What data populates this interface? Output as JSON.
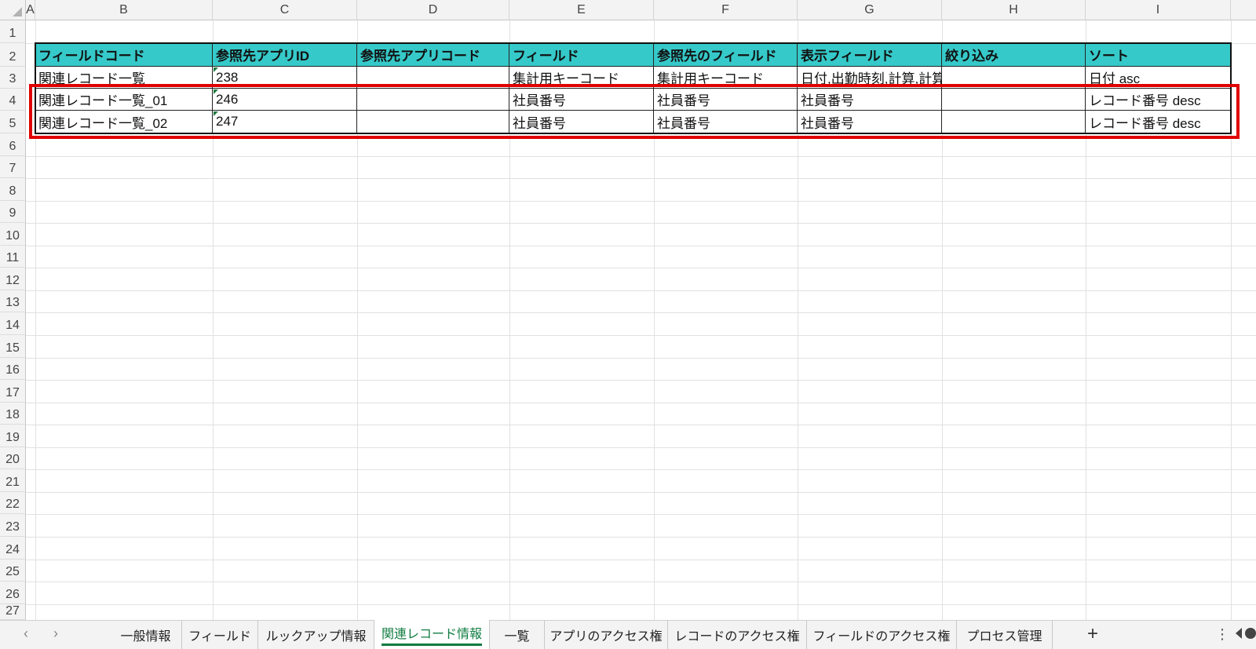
{
  "columns": [
    "A",
    "B",
    "C",
    "D",
    "E",
    "F",
    "G",
    "H",
    "I"
  ],
  "rows": [
    "1",
    "2",
    "3",
    "4",
    "5",
    "6",
    "7",
    "8",
    "9",
    "10",
    "11",
    "12",
    "13",
    "14",
    "15",
    "16",
    "17",
    "18",
    "19",
    "20",
    "21",
    "22",
    "23",
    "24",
    "25",
    "26",
    "27"
  ],
  "table": {
    "headers": [
      "フィールドコード",
      "参照先アプリID",
      "参照先アプリコード",
      "フィールド",
      "参照先のフィールド",
      "表示フィールド",
      "絞り込み",
      "ソート"
    ],
    "rows": [
      [
        "関連レコード一覧",
        "238",
        "",
        "集計用キーコード",
        "集計用キーコード",
        "日付,出勤時刻,計算,計算",
        "",
        "日付 asc"
      ],
      [
        "関連レコード一覧_01",
        "246",
        "",
        "社員番号",
        "社員番号",
        "社員番号",
        "",
        "レコード番号 desc"
      ],
      [
        "関連レコード一覧_02",
        "247",
        "",
        "社員番号",
        "社員番号",
        "社員番号",
        "",
        "レコード番号 desc"
      ]
    ]
  },
  "colors": {
    "header_fill": "#36c9c9",
    "highlight_box": "#e00000",
    "active_tab_accent": "#107c41"
  },
  "tabs": [
    "一般情報",
    "フィールド",
    "ルックアップ情報",
    "関連レコード情報",
    "一覧",
    "アプリのアクセス権",
    "レコードのアクセス権",
    "フィールドのアクセス権",
    "プロセス管理"
  ],
  "active_tab": "関連レコード情報",
  "tab_nav": {
    "prev": "‹",
    "next": "›",
    "add": "+",
    "more": "⋮"
  }
}
